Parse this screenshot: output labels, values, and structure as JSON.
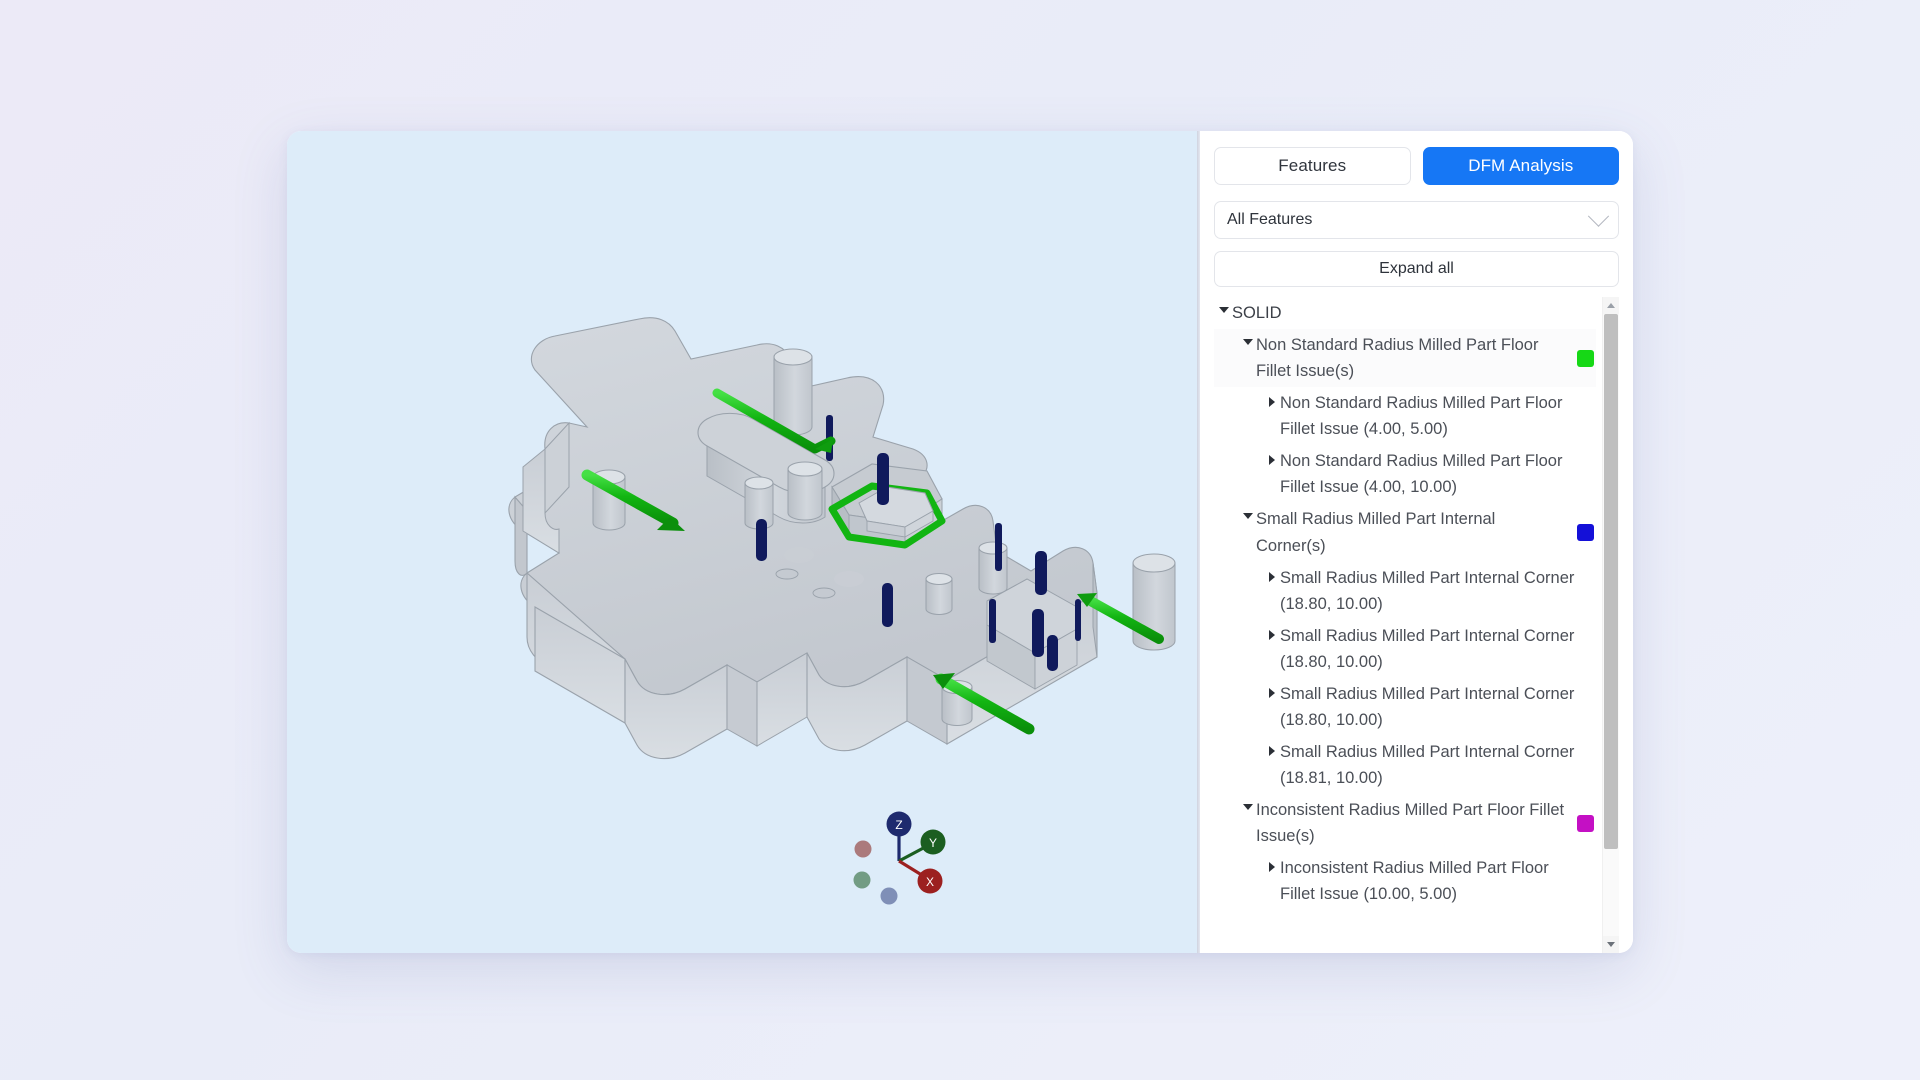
{
  "tabs": [
    {
      "label": "Features",
      "active": false,
      "name": "tab-features"
    },
    {
      "label": "DFM Analysis",
      "active": true,
      "name": "tab-dfm-analysis"
    }
  ],
  "filter": {
    "selected": "All Features",
    "icon": "chevron-down-icon"
  },
  "expand_all": {
    "label": "Expand all"
  },
  "colors": {
    "accent": "#1677f5",
    "viewport_bg": "#ddecf9",
    "page_bg": "#eceaf7",
    "swatch_green": "#16d816",
    "swatch_blue": "#1410d8",
    "swatch_magenta": "#c410c4",
    "part_grey": "#c8ccd2",
    "highlight_green": "#12b512",
    "highlight_navy": "#101a5c"
  },
  "tree": {
    "root": {
      "label": "SOLID",
      "expanded": true
    },
    "groups": [
      {
        "label": "Non Standard Radius Milled Part Floor Fillet Issue(s)",
        "expanded": true,
        "swatch": "#16d816",
        "children": [
          {
            "label": "Non Standard Radius Milled Part Floor Fillet Issue (4.00, 5.00)",
            "expanded": false
          },
          {
            "label": "Non Standard Radius Milled Part Floor Fillet Issue (4.00, 10.00)",
            "expanded": false
          }
        ]
      },
      {
        "label": "Small Radius Milled Part Internal Corner(s)",
        "expanded": true,
        "swatch": "#1410d8",
        "children": [
          {
            "label": "Small Radius Milled Part Internal Corner (18.80, 10.00)",
            "expanded": false
          },
          {
            "label": "Small Radius Milled Part Internal Corner (18.80, 10.00)",
            "expanded": false
          },
          {
            "label": "Small Radius Milled Part Internal Corner (18.80, 10.00)",
            "expanded": false
          },
          {
            "label": "Small Radius Milled Part Internal Corner (18.81, 10.00)",
            "expanded": false
          }
        ]
      },
      {
        "label": "Inconsistent Radius Milled Part Floor Fillet Issue(s)",
        "expanded": true,
        "swatch": "#c410c4",
        "children": [
          {
            "label": "Inconsistent Radius Milled Part Floor Fillet Issue (10.00, 5.00)",
            "expanded": false
          }
        ]
      }
    ]
  },
  "gizmo": {
    "axes": [
      {
        "label": "Z",
        "color": "#1e2a6e"
      },
      {
        "label": "Y",
        "color": "#1b5e20"
      },
      {
        "label": "X",
        "color": "#9c2020"
      }
    ],
    "negative_dots": [
      {
        "color": "#a06060"
      },
      {
        "color": "#5a8a6a"
      },
      {
        "color": "#6a7aa8"
      }
    ]
  }
}
